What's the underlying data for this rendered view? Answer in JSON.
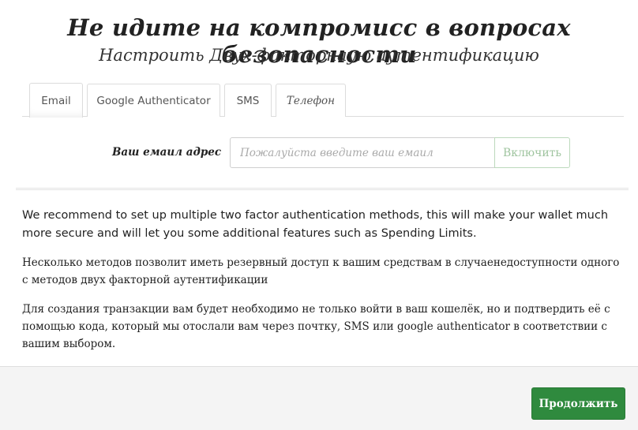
{
  "header": {
    "title": "Не идите на компромисс в вопросах безопасности",
    "subtitle": "Настроить Двух-факторнаую аутентификацию"
  },
  "tabs": [
    {
      "label": "Email",
      "active": true
    },
    {
      "label": "Google Authenticator",
      "active": false
    },
    {
      "label": "SMS",
      "active": false
    },
    {
      "label": "Телефон",
      "active": false
    }
  ],
  "email_form": {
    "label": "Ваш емаил адрес",
    "value": "",
    "placeholder": "Пожалуйста введите ваш емаил",
    "enable_label": "Включить"
  },
  "info": {
    "p1": "We recommend to set up multiple two factor authentication methods, this will make your wallet much more secure and will let you some additional features such as Spending Limits.",
    "p2": "Несколько методов позволит иметь резервный доступ к вашим средствам в случаенедоступности одного с методов двух факторной аутентификации",
    "p3": "Для создания транзакции вам будет необходимо не только войти в ваш кошелёк, но и подтвердить её с помощью кода, который мы отослали вам через почтку, SMS или google authenticator в соответствии с вашим выбором."
  },
  "footer": {
    "continue_label": "Продолжить"
  },
  "colors": {
    "accent": "#2f8a3e",
    "enable_text": "#9fc49f",
    "footer_bg": "#f4f4f4"
  }
}
